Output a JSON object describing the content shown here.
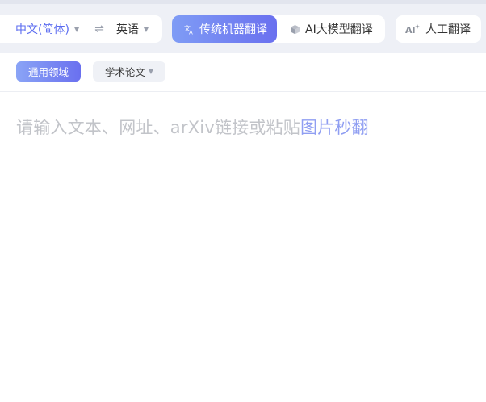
{
  "toolbar": {
    "source_language": "中文(简体)",
    "target_language": "英语",
    "swap_icon": "⇌",
    "modes": {
      "machine": "传统机器翻译",
      "ai": "AI大模型翻译",
      "human": "人工翻译"
    }
  },
  "domains": {
    "general": "通用领域",
    "academic": "学术论文"
  },
  "editor": {
    "placeholder": "请输入文本、网址、arXiv链接或粘贴",
    "image_link": "图片秒翻"
  },
  "icons": {
    "caret": "caret-down-icon",
    "swap": "swap-arrows-icon",
    "machine": "translate-icon",
    "ai": "cube-icon",
    "human": "ai-sparkle-icon"
  },
  "colors": {
    "accent": "#6a70ef",
    "accent_light": "#7f9cf5",
    "link": "#8f9ef2",
    "placeholder": "#c2c4c9"
  }
}
